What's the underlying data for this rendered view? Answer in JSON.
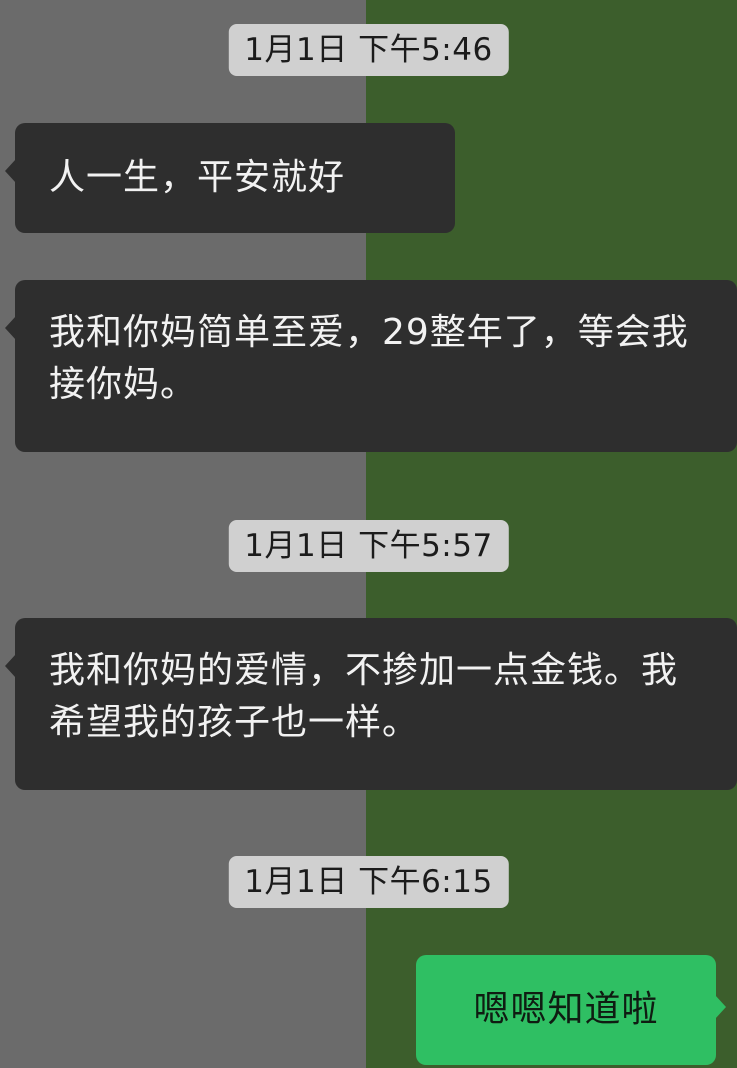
{
  "colors": {
    "bg_left": "#6b6b6b",
    "bg_right": "#3c5e2c",
    "timestamp_bg": "#d0d0d0",
    "timestamp_text": "#1b1b1b",
    "incoming_bubble": "#2e2e2e",
    "incoming_text": "#f2f2f2",
    "outgoing_bubble": "#2fbf63",
    "outgoing_text": "#0f1c12"
  },
  "messages": [
    {
      "type": "timestamp",
      "text": "1月1日 下午5:46"
    },
    {
      "type": "incoming",
      "text": "人一生，平安就好"
    },
    {
      "type": "incoming",
      "text": "我和你妈简单至爱，29整年了，等会我接你妈。"
    },
    {
      "type": "timestamp",
      "text": "1月1日 下午5:57"
    },
    {
      "type": "incoming",
      "text": "我和你妈的爱情，不掺加一点金钱。我希望我的孩子也一样。"
    },
    {
      "type": "timestamp",
      "text": "1月1日 下午6:15"
    },
    {
      "type": "outgoing",
      "text": "嗯嗯知道啦"
    }
  ]
}
